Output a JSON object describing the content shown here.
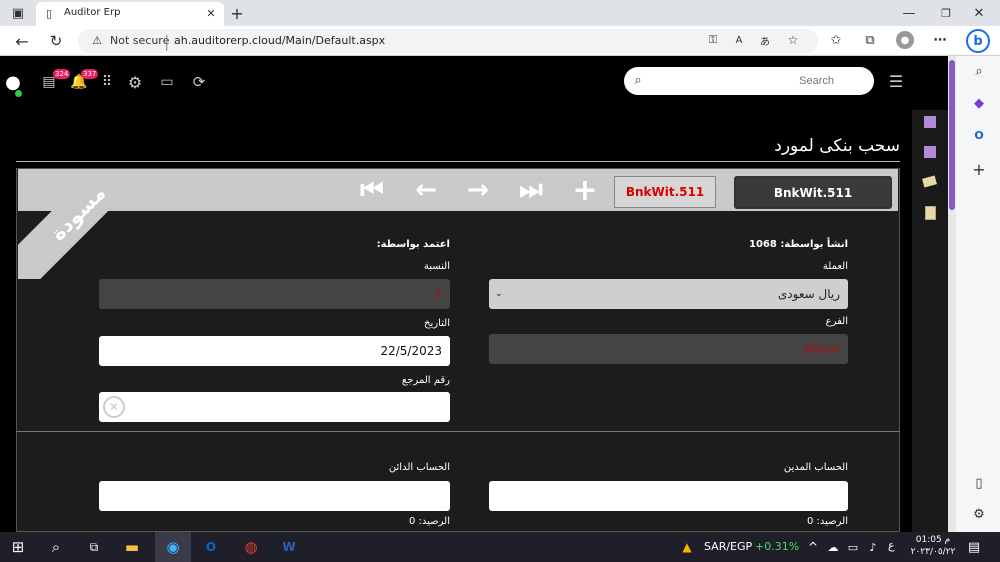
{
  "browser": {
    "tab_title": "Auditor Erp",
    "not_secure": "Not secure",
    "url": "ah.auditorerp.cloud/Main/Default.aspx"
  },
  "header": {
    "badge_1": "324",
    "badge_2": "337",
    "search_placeholder": "Search"
  },
  "page": {
    "title": "سحب بنكى لمورد",
    "draft_label": "مسودة",
    "record_code_active": "BnkWit.511",
    "record_code_secondary": "BnkWit.511"
  },
  "form": {
    "created_by_label": "انشأ بواسطة:",
    "created_by_value": "1068",
    "approved_by_label": "اعتمد بواسطة:",
    "currency_label": "العملة",
    "currency_value": "ريال سعودى",
    "ratio_label": "النسبة",
    "ratio_value": "1",
    "branch_label": "الفرع",
    "branch_value": "Abhur",
    "date_label": "التاريخ",
    "date_value": "22/5/2023",
    "ref_label": "رقم المرجع",
    "ref_value": "",
    "debit_label": "الحساب المدين",
    "credit_label": "الحساب الدائن",
    "debit_balance": "الرصيد: 0",
    "credit_balance": "الرصيد: 0"
  },
  "taskbar": {
    "currency_pair": "SAR/EGP",
    "change": "+0.31%",
    "lang": "ع",
    "time": "01:05 م",
    "date": "٢٠٢٣/٠٥/٢٢"
  }
}
